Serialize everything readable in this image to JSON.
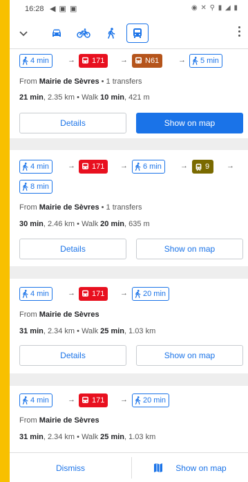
{
  "status": {
    "time": "16:28",
    "left_icons": "◀ ▣ ▣",
    "right_icons": "◉ ✕ ⚲ ▮ ◢ ▮"
  },
  "modes": [
    "car-icon",
    "bike-icon",
    "walk-icon",
    "transit-icon"
  ],
  "colors": {
    "accent": "#1a73e8",
    "bus_171": "#e8101f",
    "bus_n61": "#b5541b",
    "tram_9": "#7a6a00",
    "frame": "#f8c000"
  },
  "routes": [
    {
      "steps": {
        "walk1": "4 min",
        "bus1": "171",
        "bus2": "N61",
        "walk2": "5 min"
      },
      "from_prefix": "From",
      "from_stop": "Mairie de Sèvres",
      "transfers": "• 1 transfers",
      "duration": "21 min",
      "distance": ", 2.35 km  •  Walk ",
      "walk_time": "10 min",
      "walk_distance": ", 421 m",
      "details_label": "Details",
      "show_map_label": "Show on map"
    },
    {
      "steps": {
        "walk1": "4 min",
        "bus1": "171",
        "walk2": "6 min",
        "tram": "9",
        "walk3": "8 min"
      },
      "from_prefix": "From",
      "from_stop": "Mairie de Sèvres",
      "transfers": "• 1 transfers",
      "duration": "30 min",
      "distance": ", 2.46 km  •  Walk ",
      "walk_time": "20 min",
      "walk_distance": ", 635 m",
      "details_label": "Details",
      "show_map_label": "Show on map"
    },
    {
      "steps": {
        "walk1": "4 min",
        "bus1": "171",
        "walk2": "20 min"
      },
      "from_prefix": "From",
      "from_stop": "Mairie de Sèvres",
      "duration": "31 min",
      "distance": ", 2.34 km  •  Walk ",
      "walk_time": "25 min",
      "walk_distance": ", 1.03 km",
      "details_label": "Details",
      "show_map_label": "Show on map"
    },
    {
      "steps": {
        "walk1": "4 min",
        "bus1": "171",
        "walk2": "20 min"
      },
      "from_prefix": "From",
      "from_stop": "Mairie de Sèvres",
      "duration": "31 min",
      "distance": ", 2.34 km  •  Walk ",
      "walk_time": "25 min",
      "walk_distance": ", 1.03 km"
    }
  ],
  "bottom": {
    "dismiss": "Dismiss",
    "show_map": "Show on map"
  }
}
